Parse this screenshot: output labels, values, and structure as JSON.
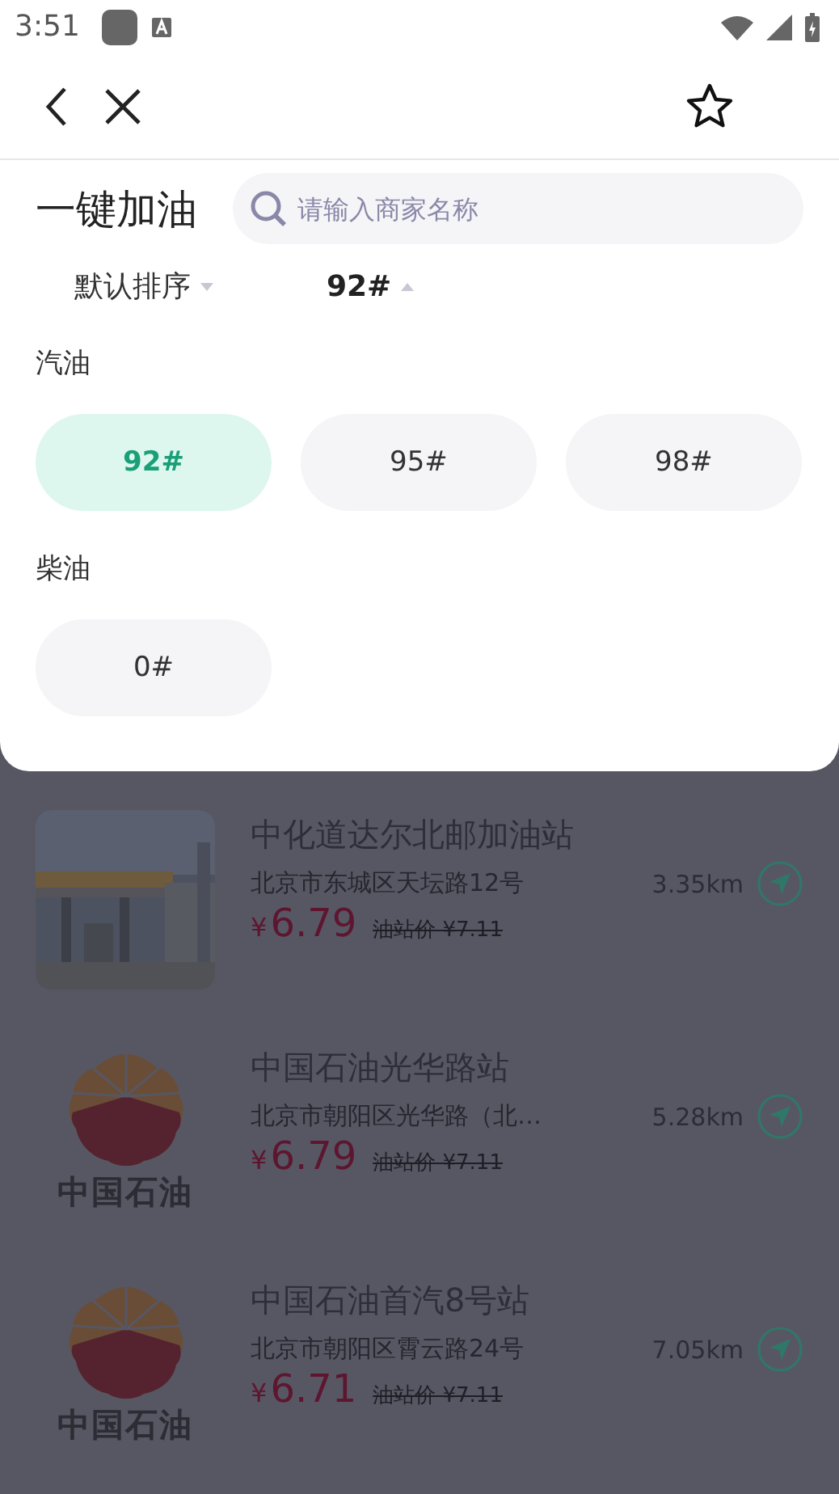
{
  "status_bar": {
    "time": "3:51"
  },
  "filter_panel": {
    "title": "一键加油",
    "search": {
      "placeholder": "请输入商家名称"
    },
    "sorts": [
      {
        "label": "默认排序",
        "selected": false,
        "expanded": false
      },
      {
        "label": "92#",
        "selected": true,
        "expanded": true
      }
    ],
    "groups": [
      {
        "label": "汽油",
        "options": [
          {
            "label": "92#",
            "selected": true
          },
          {
            "label": "95#",
            "selected": false
          },
          {
            "label": "98#",
            "selected": false
          }
        ]
      },
      {
        "label": "柴油",
        "options": [
          {
            "label": "0#",
            "selected": false
          }
        ]
      }
    ]
  },
  "stations": [
    {
      "name": "中化道达尔北邮加油站",
      "address": "北京市东城区天坛路12号",
      "price": "6.79",
      "currency": "¥",
      "list_price": "油站价 ¥7.11",
      "distance": "3.35km"
    },
    {
      "kind": "logo",
      "logo_text": "中国石油",
      "name": "中国石油光华路站",
      "address": "北京市朝阳区光华路（北…",
      "price": "6.79",
      "currency": "¥",
      "list_price": "油站价 ¥7.11",
      "distance": "5.28km"
    },
    {
      "kind": "logo",
      "logo_text": "中国石油",
      "name": "中国石油首汽8号站",
      "address": "北京市朝阳区霄云路24号",
      "price": "6.71",
      "currency": "¥",
      "list_price": "油站价 ¥7.11",
      "distance": "7.05km"
    }
  ]
}
